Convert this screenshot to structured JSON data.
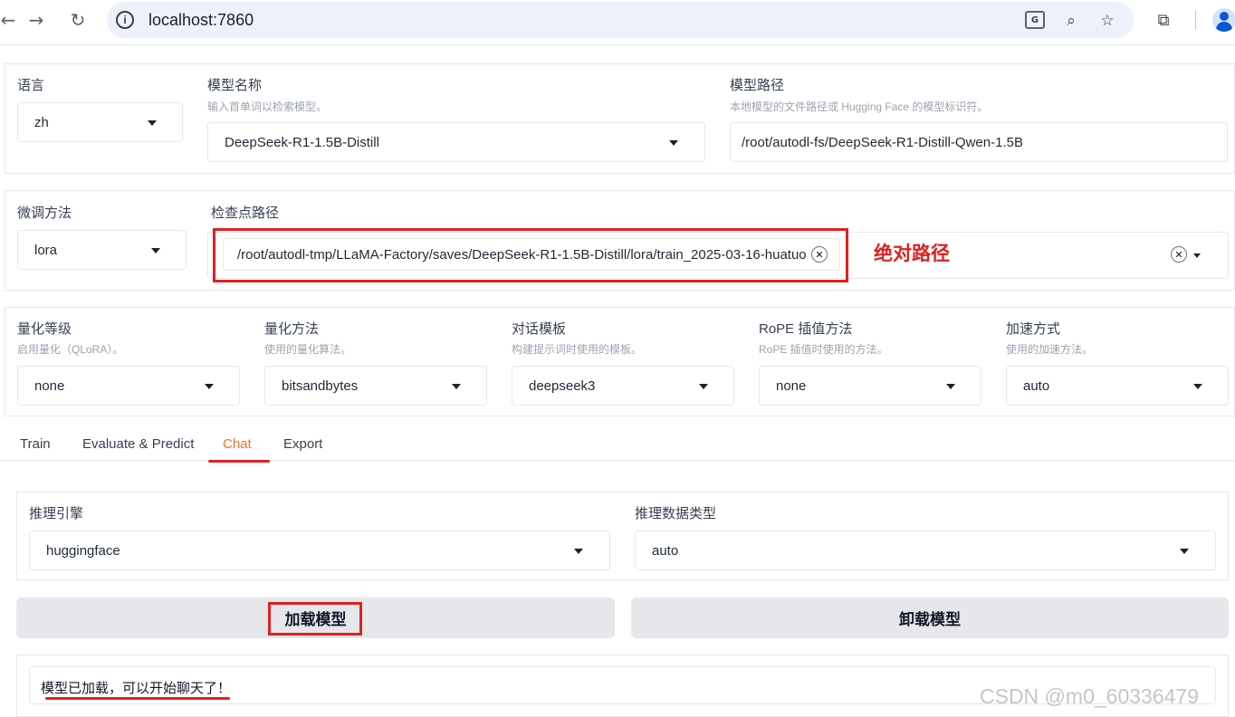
{
  "browser": {
    "url": "localhost:7860",
    "back_icon": "arrow-left-icon",
    "forward_icon": "arrow-right-icon",
    "reload_icon": "reload-icon"
  },
  "top": {
    "lang_label": "语言",
    "lang_value": "zh",
    "model_name_label": "模型名称",
    "model_name_info": "输入首单词以检索模型。",
    "model_name_value": "DeepSeek-R1-1.5B-Distill",
    "model_path_label": "模型路径",
    "model_path_info": "本地模型的文件路径或 Hugging Face 的模型标识符。",
    "model_path_value": "/root/autodl-fs/DeepSeek-R1-Distill-Qwen-1.5B"
  },
  "finetune": {
    "method_label": "微调方法",
    "method_value": "lora",
    "checkpoint_label": "检查点路径",
    "checkpoint_value": "/root/autodl-tmp/LLaMA-Factory/saves/DeepSeek-R1-1.5B-Distill/lora/train_2025-03-16-huatuo",
    "annotation": "绝对路径"
  },
  "advanced": {
    "quant_bit_label": "量化等级",
    "quant_bit_info": "启用量化（QLoRA）。",
    "quant_bit_value": "none",
    "quant_method_label": "量化方法",
    "quant_method_info": "使用的量化算法。",
    "quant_method_value": "bitsandbytes",
    "template_label": "对话模板",
    "template_info": "构建提示词时使用的模板。",
    "template_value": "deepseek3",
    "rope_label": "RoPE 插值方法",
    "rope_info": "RoPE 插值时使用的方法。",
    "rope_value": "none",
    "booster_label": "加速方式",
    "booster_info": "使用的加速方法。",
    "booster_value": "auto"
  },
  "tabs": [
    "Train",
    "Evaluate & Predict",
    "Chat",
    "Export"
  ],
  "chat": {
    "backend_label": "推理引擎",
    "backend_value": "huggingface",
    "dtype_label": "推理数据类型",
    "dtype_value": "auto",
    "load_button": "加载模型",
    "unload_button": "卸载模型",
    "info_box": "模型已加载，可以开始聊天了！"
  },
  "watermark": "CSDN @m0_60336479",
  "colors": {
    "accent_orange": "#f97316",
    "annotation_red": "#e02020",
    "button_gray": "#e5e7eb"
  }
}
